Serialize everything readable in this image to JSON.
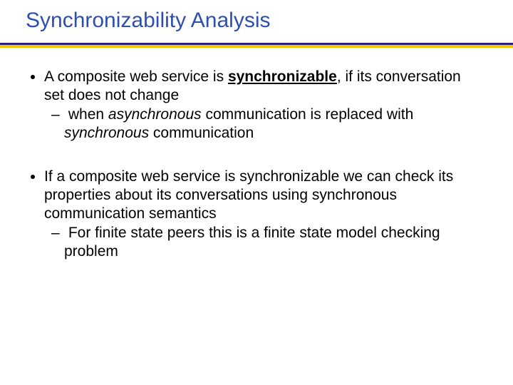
{
  "title": "Synchronizability Analysis",
  "block1": {
    "lead_a": "A composite web service is ",
    "lead_b_bold_under": "synchronizable",
    "lead_c": ", if its conversation set does not change",
    "sub_a": "when ",
    "sub_b_ital": "asynchronous",
    "sub_c": " communication is replaced with ",
    "sub_d_ital": "synchronous",
    "sub_e": " communication"
  },
  "block2": {
    "lead": "If a composite web service is synchronizable we can check its properties about its conversations using synchronous communication semantics",
    "sub": "For finite state peers this is a finite state model checking problem"
  }
}
